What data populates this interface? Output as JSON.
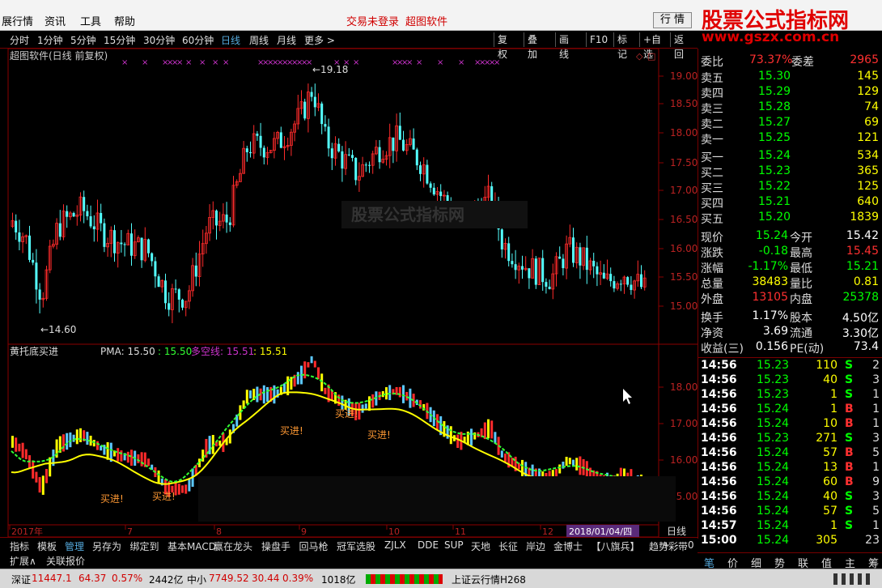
{
  "titlebar": {
    "menu": [
      "展行情",
      "资讯",
      "工具",
      "帮助"
    ],
    "login": "交易未登录",
    "brand": "超图软件",
    "main_button": "行 情"
  },
  "watermark": {
    "line1": "股票公式指标网",
    "line2": "www.gszx.com.cn"
  },
  "periods": [
    "分时",
    "1分钟",
    "5分钟",
    "15分钟",
    "30分钟",
    "60分钟",
    "日线",
    "周线",
    "月线",
    "更多 >"
  ],
  "active_period": "日线",
  "right_tools": [
    "复权",
    "叠加",
    "画线",
    "F10",
    "标记",
    "+自选",
    "返回"
  ],
  "main_chart": {
    "title": "超图软件(日线 前复权)",
    "high_label": "19.18",
    "low_label": "14.60",
    "price_ticks": [
      "19.00",
      "18.50",
      "18.00",
      "17.50",
      "17.00",
      "16.50",
      "16.00",
      "15.50",
      "15.00"
    ],
    "obscured_text": "股票公式指标网"
  },
  "indicator": {
    "name": "黄托底买进",
    "pma_label": "PMA: 15.50",
    "v2": ": 15.50",
    "dk_label": "多空线: 15.51",
    "v4": ": 15.51",
    "ticks": [
      "18.00",
      "17.00",
      "16.00",
      "15.00"
    ],
    "signal": "买进!"
  },
  "xaxis": {
    "labels": [
      "2017年",
      "7",
      "8",
      "9",
      "10",
      "11",
      "12"
    ],
    "date_box": "2018/01/04/四",
    "period": "日线"
  },
  "chart_data": {
    "type": "table",
    "candles": []
  },
  "quote": {
    "wb_label": "委比",
    "wb": "73.37%",
    "wc_label": "委差",
    "wc": "2965",
    "sells": [
      {
        "l": "卖五",
        "p": "15.30",
        "v": "145"
      },
      {
        "l": "卖四",
        "p": "15.29",
        "v": "129"
      },
      {
        "l": "卖三",
        "p": "15.28",
        "v": "74"
      },
      {
        "l": "卖二",
        "p": "15.27",
        "v": "69"
      },
      {
        "l": "卖一",
        "p": "15.25",
        "v": "121"
      }
    ],
    "buys": [
      {
        "l": "买一",
        "p": "15.24",
        "v": "534"
      },
      {
        "l": "买二",
        "p": "15.23",
        "v": "365"
      },
      {
        "l": "买三",
        "p": "15.22",
        "v": "125"
      },
      {
        "l": "买四",
        "p": "15.21",
        "v": "640"
      },
      {
        "l": "买五",
        "p": "15.20",
        "v": "1839"
      }
    ],
    "stats": [
      {
        "l1": "现价",
        "v1": "15.24",
        "c1": "#00ff00",
        "l2": "今开",
        "v2": "15.42",
        "c2": "#fff"
      },
      {
        "l1": "涨跌",
        "v1": "-0.18",
        "c1": "#00ff00",
        "l2": "最高",
        "v2": "15.45",
        "c2": "#ff3030"
      },
      {
        "l1": "涨幅",
        "v1": "-1.17%",
        "c1": "#00ff00",
        "l2": "最低",
        "v2": "15.21",
        "c2": "#00ff00"
      },
      {
        "l1": "总量",
        "v1": "38483",
        "c1": "#ffff00",
        "l2": "量比",
        "v2": "0.81",
        "c2": "#ffff00"
      },
      {
        "l1": "外盘",
        "v1": "13105",
        "c1": "#ff3030",
        "l2": "内盘",
        "v2": "25378",
        "c2": "#00ff00"
      }
    ],
    "stats2": [
      {
        "l1": "换手",
        "v1": "1.17%",
        "l2": "股本",
        "v2": "4.50亿"
      },
      {
        "l1": "净资",
        "v1": "3.69",
        "l2": "流通",
        "v2": "3.30亿"
      },
      {
        "l1": "收益(三)",
        "v1": "0.156",
        "l2": "PE(动)",
        "v2": "73.4"
      }
    ]
  },
  "ticks": [
    {
      "t": "14:56",
      "p": "15.23",
      "v": "110",
      "d": "S",
      "n": "2"
    },
    {
      "t": "14:56",
      "p": "15.23",
      "v": "40",
      "d": "S",
      "n": "3"
    },
    {
      "t": "14:56",
      "p": "15.23",
      "v": "1",
      "d": "S",
      "n": "1"
    },
    {
      "t": "14:56",
      "p": "15.24",
      "v": "1",
      "d": "B",
      "n": "1"
    },
    {
      "t": "14:56",
      "p": "15.24",
      "v": "10",
      "d": "B",
      "n": "1"
    },
    {
      "t": "14:56",
      "p": "15.23",
      "v": "271",
      "d": "S",
      "n": "3"
    },
    {
      "t": "14:56",
      "p": "15.24",
      "v": "57",
      "d": "B",
      "n": "5"
    },
    {
      "t": "14:56",
      "p": "15.24",
      "v": "13",
      "d": "B",
      "n": "1"
    },
    {
      "t": "14:56",
      "p": "15.24",
      "v": "60",
      "d": "B",
      "n": "9"
    },
    {
      "t": "14:56",
      "p": "15.24",
      "v": "40",
      "d": "S",
      "n": "3"
    },
    {
      "t": "14:56",
      "p": "15.24",
      "v": "57",
      "d": "S",
      "n": "5"
    },
    {
      "t": "14:57",
      "p": "15.24",
      "v": "1",
      "d": "S",
      "n": "1"
    },
    {
      "t": "15:00",
      "p": "15.24",
      "v": "305",
      "d": "",
      "n": "23"
    }
  ],
  "tabs": [
    "指标",
    "模板",
    "管理",
    "另存为",
    "绑定到",
    "基本MACD",
    "赢在龙头",
    "操盘手",
    "回马枪",
    "冠军选股",
    "ZJLX",
    "DDE",
    "SUP",
    "天地",
    "长征",
    "岸边",
    "金博士",
    "【八旗兵】",
    "趋势彩带"
  ],
  "tab_controls": [
    "+",
    "-",
    "0"
  ],
  "extbar": [
    "扩展∧",
    "关联报价"
  ],
  "right_tabs": [
    "笔",
    "价",
    "细",
    "势",
    "联",
    "值",
    "主",
    "筹"
  ],
  "status": {
    "sz_label": "深证",
    "sz": "11447.1",
    "sz_chg": "64.37",
    "sz_pct": "0.57%",
    "sz_amt": "2442亿",
    "zx_label": "中小",
    "zx": "7749.52",
    "zx_chg": "30.44",
    "zx_pct": "0.39%",
    "zx_amt": "1018亿",
    "server": "上证云行情H268"
  }
}
